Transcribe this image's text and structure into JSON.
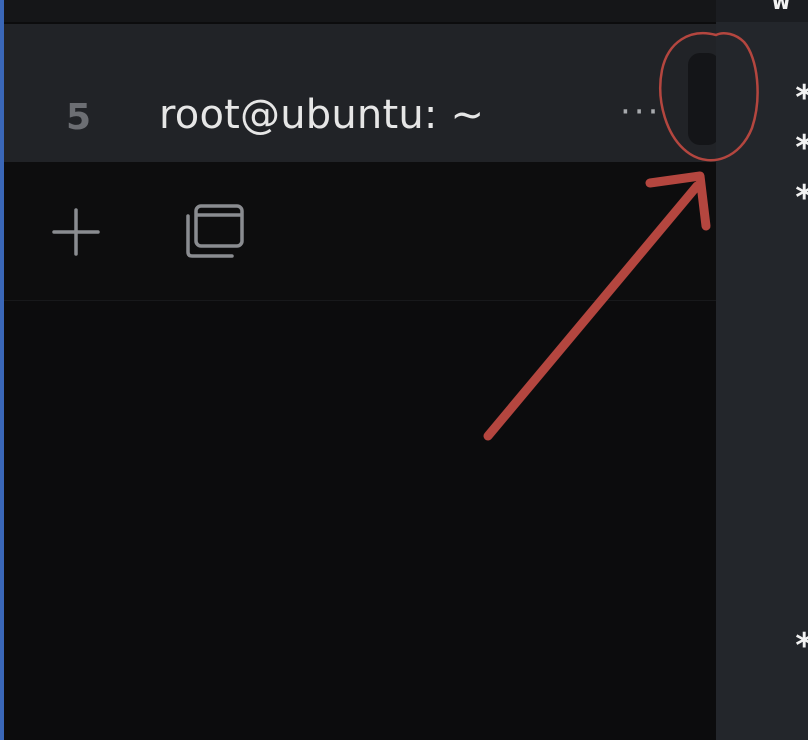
{
  "tab": {
    "index": "5",
    "title": "root@ubuntu: ~",
    "more": "···"
  },
  "toolbar": {
    "new_tab_icon": "plus-icon",
    "windows_icon": "windows-stack-icon"
  },
  "terminal": {
    "partial_top_text": "w",
    "bullets": [
      "*",
      "*",
      "*",
      "*"
    ]
  },
  "annotation": {
    "color": "#b4463f",
    "shapes": [
      "circle",
      "arrow"
    ]
  },
  "colors": {
    "active_tab_bg": "#212327",
    "panel_bg": "#0c0c0d",
    "terminal_bg": "#23262b",
    "left_accent": "#3a67b8"
  }
}
